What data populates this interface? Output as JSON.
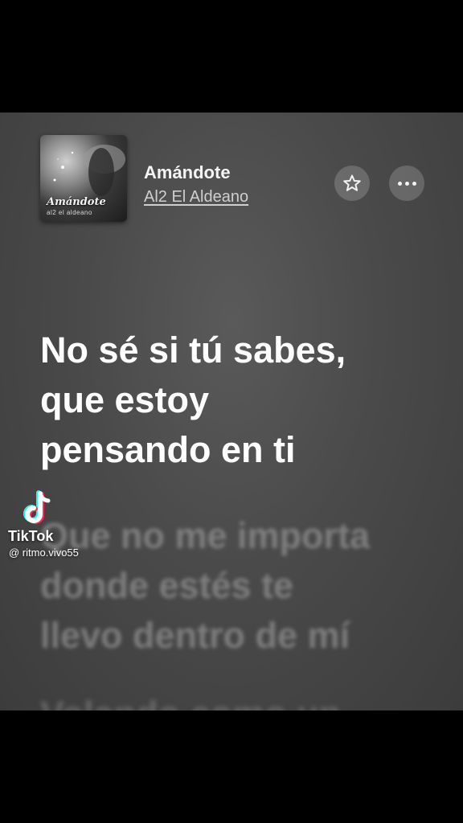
{
  "track": {
    "title": "Amándote",
    "artist": "Al2 El Aldeano",
    "cover": {
      "title_text": "Amándote",
      "subtitle_text": "al2 el aldeano"
    }
  },
  "actions": {
    "favorite_icon": "star-icon",
    "more_icon": "more-horizontal-icon"
  },
  "lyrics": {
    "current": [
      "No sé si tú sabes,",
      "que estoy",
      "pensando en ti"
    ],
    "next": [
      "Que no me importa",
      "donde estés te",
      "llevo dentro de mí"
    ],
    "partial": "Volando como un"
  },
  "watermark": {
    "brand": "TikTok",
    "username": "@ ritmo.vivo55"
  },
  "colors": {
    "background": "#000000",
    "screen": "#4a4a4a",
    "active_lyric": "#ffffff",
    "inactive_lyric": "#9a9a9a"
  }
}
